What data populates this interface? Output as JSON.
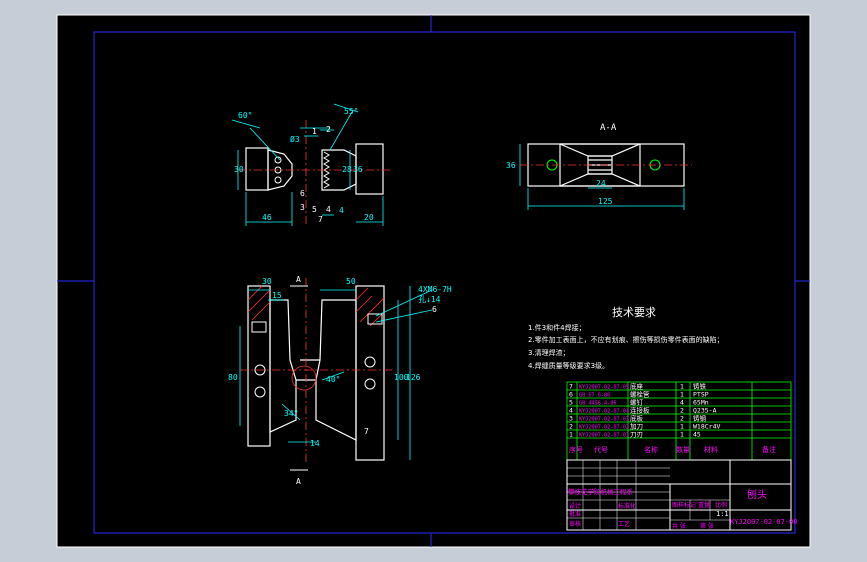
{
  "colors": {
    "background_outer": "#c6cdd6",
    "sheet": "#000000",
    "outer_border": "#ffffff",
    "inner_border": "#2b2bff",
    "part": "#ffffff",
    "dimension": "#00ffff",
    "centerline": "#ff3030",
    "hatch": "#ff3030",
    "text_heading": "#ffffff",
    "text_requirements": "#ffffff",
    "table_lines": "#00ff00",
    "table_text": "#ff00ff",
    "title_block_text": "#ff00ff"
  },
  "views": {
    "view1": {
      "angle_left": "60°",
      "angle_right": "55°",
      "dims": [
        "46",
        "30",
        "4",
        "20",
        "28",
        "36"
      ],
      "part_numbers": [
        "1",
        "2",
        "3",
        "4",
        "5",
        "6",
        "7"
      ],
      "phi_label": "Ø3"
    },
    "view_aa": {
      "title": "A-A",
      "dims": [
        "36",
        "24",
        "125"
      ]
    },
    "view3": {
      "dims": [
        "30",
        "50",
        "15",
        "80",
        "100",
        "126",
        "14",
        "34°",
        "40°"
      ],
      "thread_label": "4XM6-7H",
      "thread_depth": "孔↓14",
      "section_marks": [
        "A",
        "A"
      ],
      "part_numbers": [
        "6",
        "7"
      ]
    }
  },
  "requirements": {
    "title": "技术要求",
    "items": [
      "1.件3和件4焊接；",
      "2.零件加工表面上，不应有划痕、擦伤等损伤零件表面的缺陷；",
      "3.清理焊渣；",
      "4.焊缝质量等级要求3级。"
    ]
  },
  "parts_table": {
    "rows": [
      {
        "no": "7",
        "code": "KYJ2007-02-07-05",
        "name": "底座",
        "qty": "1",
        "material": "铸铁"
      },
      {
        "no": "6",
        "code": "GB 57.6-86",
        "name": "螺栓管",
        "qty": "1",
        "material": "PTSP"
      },
      {
        "no": "5",
        "code": "GB 4456.4-86",
        "name": "螺钉",
        "qty": "4",
        "material": "65Mn"
      },
      {
        "no": "4",
        "code": "KYJ2007-02-07-04",
        "name": "连接板",
        "qty": "2",
        "material": "Q235-A"
      },
      {
        "no": "3",
        "code": "KYJ2007-02-07-03",
        "name": "底板",
        "qty": "2",
        "material": "铸钢"
      },
      {
        "no": "2",
        "code": "KYJ2007-02-07-02",
        "name": "加刀",
        "qty": "1",
        "material": "W18Cr4V"
      },
      {
        "no": "1",
        "code": "KYJ2007-02-07-01",
        "name": "刀刃",
        "qty": "1",
        "material": "45"
      }
    ],
    "header": {
      "no": "序号",
      "code": "代号",
      "name": "名称",
      "qty": "数量",
      "material": "材料",
      "note": "备注"
    }
  },
  "title_block": {
    "drawing_name": "刨头",
    "drawing_number": "KYJ2007-02-07-00",
    "scale": "1:1",
    "company": "攀枝花学院机械工程系",
    "labels": [
      "设计",
      "审核",
      "工艺",
      "标准化",
      "批准",
      "图样标记",
      "重量",
      "比例",
      "共 张",
      "第 张"
    ]
  }
}
